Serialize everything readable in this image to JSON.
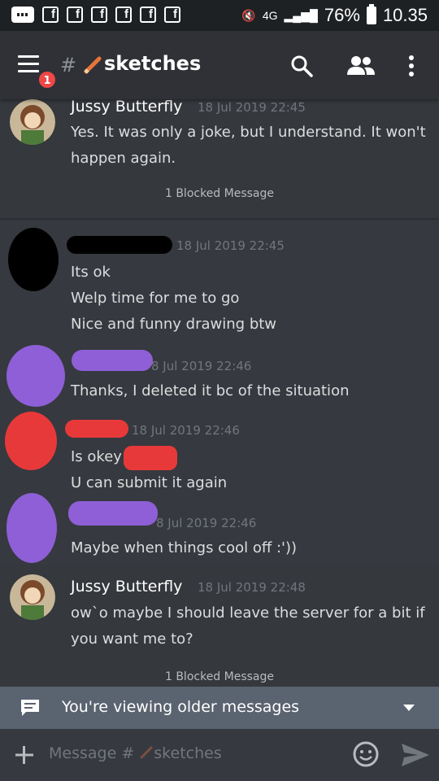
{
  "status_bar": {
    "battery": "76%",
    "time": "10.35",
    "network": "4G"
  },
  "header": {
    "channel_name": "sketches",
    "unread_badge": "1"
  },
  "messages": [
    {
      "author": "Jussy Butterfly",
      "timestamp": "18 Jul 2019 22:45",
      "lines": [
        "Yes. It was only a joke, but I understand. It won't",
        "happen again."
      ],
      "blocked": "1 Blocked Message"
    },
    {
      "timestamp": "18 Jul 2019 22:45",
      "lines": [
        "Its ok",
        "Welp time for me to go",
        "Nice and funny drawing btw"
      ]
    },
    {
      "timestamp": "8 Jul 2019 22:46",
      "lines": [
        "Thanks, I deleted it bc of the situation"
      ]
    },
    {
      "timestamp": "18 Jul 2019 22:46",
      "lines": [
        "Is okey",
        "U can submit it again"
      ]
    },
    {
      "timestamp": "8 Jul 2019 22:46",
      "lines": [
        "Maybe when things cool off :'))"
      ]
    },
    {
      "author": "Jussy Butterfly",
      "timestamp": "18 Jul 2019 22:48",
      "lines": [
        "ow`o maybe I should leave the server for a bit if",
        "you want me to?"
      ],
      "blocked": "1 Blocked Message"
    }
  ],
  "older_banner": {
    "text": "You're viewing older messages"
  },
  "composer": {
    "placeholder": "Message # ",
    "channel": "sketches"
  },
  "colors": {
    "redaction_black": "#000000",
    "redaction_purple": "#8e5fd6",
    "redaction_red": "#e8393a"
  }
}
